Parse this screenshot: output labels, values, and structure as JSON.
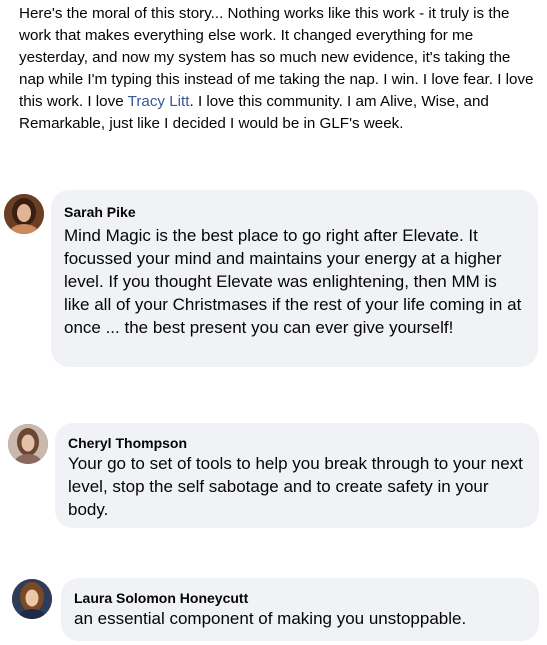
{
  "post": {
    "text_before_mention": "Here's the moral of this story... Nothing works like this work - it truly is the work that makes everything else work. It changed everything for me yesterday, and now my system has so much new evidence, it's taking the nap while I'm typing this instead of me taking the nap. I win. I love fear. I love this work. I love ",
    "mention": "Tracy Litt",
    "text_after_mention": ". I love this community. I am Alive, Wise, and Remarkable, just like I decided I would be in GLF's week."
  },
  "comments": [
    {
      "author": "Sarah Pike",
      "text": "Mind Magic is the best place to go right after Elevate. It focussed your mind and maintains your energy at a higher level. If you thought Elevate was enlightening, then MM is like all of your Christmases if the rest of your life coming in at once ... the best present you can ever give yourself!"
    },
    {
      "author": "Cheryl Thompson",
      "text": "Your go to set of tools to help you break through to your next level, stop the self sabotage and to create safety in your body."
    },
    {
      "author": "Laura Solomon Honeycutt",
      "text": "an essential component of making you unstoppable."
    }
  ]
}
